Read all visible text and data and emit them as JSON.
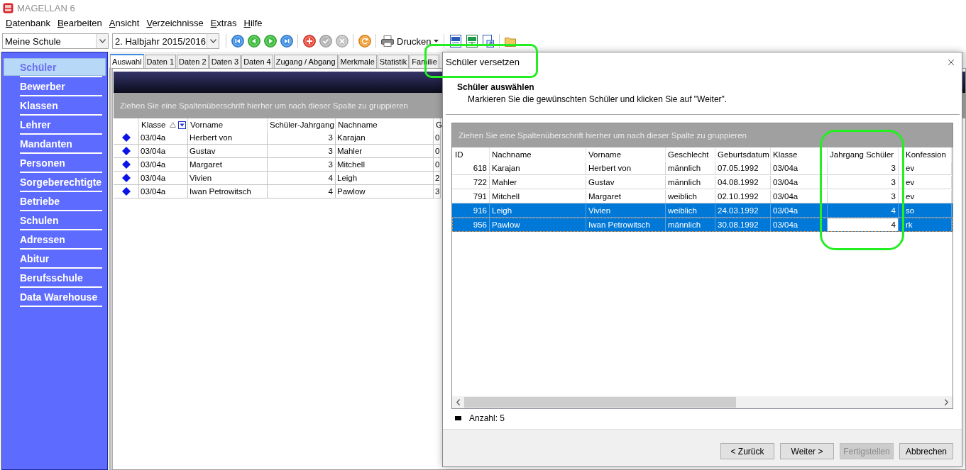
{
  "app": {
    "title": "MAGELLAN 6"
  },
  "menu": [
    {
      "label": "Datenbank"
    },
    {
      "label": "Bearbeiten"
    },
    {
      "label": "Ansicht"
    },
    {
      "label": "Verzeichnisse"
    },
    {
      "label": "Extras"
    },
    {
      "label": "Hilfe"
    }
  ],
  "toolbar": {
    "school": {
      "value": "Meine Schule"
    },
    "term": {
      "value": "2. Halbjahr 2015/2016"
    },
    "print": {
      "label": "Drucken"
    }
  },
  "sidebar": {
    "items": [
      {
        "label": "Schüler",
        "selected": true
      },
      {
        "label": "Bewerber",
        "selected": false
      },
      {
        "label": "Klassen",
        "selected": false
      },
      {
        "label": "Lehrer",
        "selected": false
      },
      {
        "label": "Mandanten",
        "selected": false
      },
      {
        "label": "Personen",
        "selected": false
      },
      {
        "label": "Sorgeberechtigte",
        "selected": false
      },
      {
        "label": "Betriebe",
        "selected": false
      },
      {
        "label": "Schulen",
        "selected": false
      },
      {
        "label": "Adressen",
        "selected": false
      },
      {
        "label": "Abitur",
        "selected": false
      },
      {
        "label": "Berufsschule",
        "selected": false
      },
      {
        "label": "Data Warehouse",
        "selected": false
      }
    ]
  },
  "tabs": [
    {
      "label": "Auswahl",
      "selected": true
    },
    {
      "label": "Daten 1",
      "selected": false
    },
    {
      "label": "Daten 2",
      "selected": false
    },
    {
      "label": "Daten 3",
      "selected": false
    },
    {
      "label": "Daten 4",
      "selected": false
    },
    {
      "label": "Zugang / Abgang",
      "selected": false
    },
    {
      "label": "Merkmale",
      "selected": false
    },
    {
      "label": "Statistik",
      "selected": false
    },
    {
      "label": "Familie",
      "selected": false
    }
  ],
  "student_list": {
    "group_hint": "Ziehen Sie eine Spaltenüberschrift hierher um nach dieser Spalte zu gruppieren",
    "columns": [
      {
        "label": "Klasse",
        "kind": "text",
        "sorted_ascending": true,
        "filter": true
      },
      {
        "label": "Vorname",
        "kind": "text",
        "sorted_ascending": false,
        "filter": false
      },
      {
        "label": "Schüler-Jahrgang",
        "kind": "number",
        "sorted_ascending": false,
        "filter": false
      },
      {
        "label": "Nachname",
        "kind": "text",
        "sorted_ascending": false,
        "filter": false
      },
      {
        "label": "G",
        "kind": "text",
        "sorted_ascending": false,
        "filter": false
      }
    ],
    "rows": [
      {
        "cells": [
          "03/04a",
          "Herbert von",
          "3",
          "Karajan",
          "0"
        ]
      },
      {
        "cells": [
          "03/04a",
          "Gustav",
          "3",
          "Mahler",
          "0"
        ]
      },
      {
        "cells": [
          "03/04a",
          "Margaret",
          "3",
          "Mitchell",
          "0"
        ]
      },
      {
        "cells": [
          "03/04a",
          "Vivien",
          "4",
          "Leigh",
          "2"
        ]
      },
      {
        "cells": [
          "03/04a",
          "Iwan Petrowitsch",
          "4",
          "Pawlow",
          "3"
        ]
      }
    ]
  },
  "dialog": {
    "title": "Schüler versetzen",
    "heading": "Schüler auswählen",
    "instruction": "Markieren Sie die gewünschten Schüler und klicken Sie auf \"Weiter\".",
    "grid": {
      "group_hint": "Ziehen Sie eine Spaltenüberschrift hierher um nach dieser Spalte zu gruppieren",
      "columns": [
        {
          "label": "ID",
          "kind": "number",
          "cursor": false
        },
        {
          "label": "Nachname",
          "kind": "text",
          "cursor": false
        },
        {
          "label": "Vorname",
          "kind": "text",
          "cursor": false
        },
        {
          "label": "Geschlecht",
          "kind": "text",
          "cursor": false
        },
        {
          "label": "Geburtsdatum",
          "kind": "text",
          "cursor": false
        },
        {
          "label": "Klasse",
          "kind": "text",
          "cursor": false
        },
        {
          "label": "Jahrgang Schüler",
          "kind": "number",
          "cursor": true
        },
        {
          "label": "Konfession",
          "kind": "text",
          "cursor": false
        }
      ],
      "rows": [
        {
          "cells": [
            "618",
            "Karajan",
            "Herbert von",
            "männlich",
            "07.05.1992",
            "03/04a",
            "3",
            "ev"
          ],
          "selected": false,
          "current": false
        },
        {
          "cells": [
            "722",
            "Mahler",
            "Gustav",
            "männlich",
            "04.08.1992",
            "03/04a",
            "3",
            "ev"
          ],
          "selected": false,
          "current": false
        },
        {
          "cells": [
            "791",
            "Mitchell",
            "Margaret",
            "weiblich",
            "02.10.1992",
            "03/04a",
            "3",
            "ev"
          ],
          "selected": false,
          "current": false
        },
        {
          "cells": [
            "916",
            "Leigh",
            "Vivien",
            "weiblich",
            "24.03.1992",
            "03/04a",
            "4",
            "so"
          ],
          "selected": true,
          "current": false
        },
        {
          "cells": [
            "956",
            "Pawlow",
            "Iwan Petrowitsch",
            "männlich",
            "30.08.1992",
            "03/04a",
            "4",
            "rk"
          ],
          "selected": true,
          "current": true
        }
      ]
    },
    "count": "Anzahl: 5",
    "buttons": [
      {
        "label": "< Zurück",
        "disabled": false
      },
      {
        "label": "Weiter >",
        "disabled": false
      },
      {
        "label": "Fertigstellen",
        "disabled": true
      },
      {
        "label": "Abbrechen",
        "disabled": false
      }
    ]
  }
}
